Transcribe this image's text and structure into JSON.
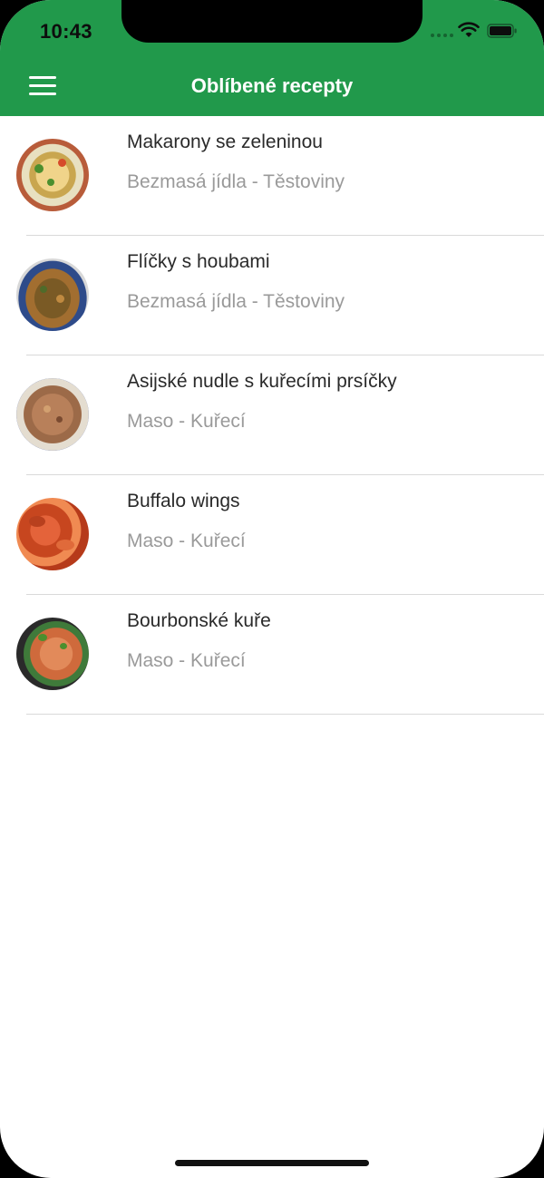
{
  "status_bar": {
    "time": "10:43",
    "icons": [
      "signal-icon",
      "wifi-icon",
      "battery-icon"
    ]
  },
  "nav_bar": {
    "title": "Oblíbené recepty",
    "menu_icon": "hamburger-menu-icon",
    "color": "#21994b"
  },
  "recipes": [
    {
      "title": "Makarony se zeleninou",
      "category": "Bezmasá jídla - Těstoviny"
    },
    {
      "title": "Flíčky s houbami",
      "category": "Bezmasá jídla - Těstoviny"
    },
    {
      "title": "Asijské nudle s kuřecími prsíčky",
      "category": "Maso - Kuřecí"
    },
    {
      "title": "Buffalo wings",
      "category": "Maso - Kuřecí"
    },
    {
      "title": "Bourbonské kuře",
      "category": "Maso - Kuřecí"
    }
  ]
}
